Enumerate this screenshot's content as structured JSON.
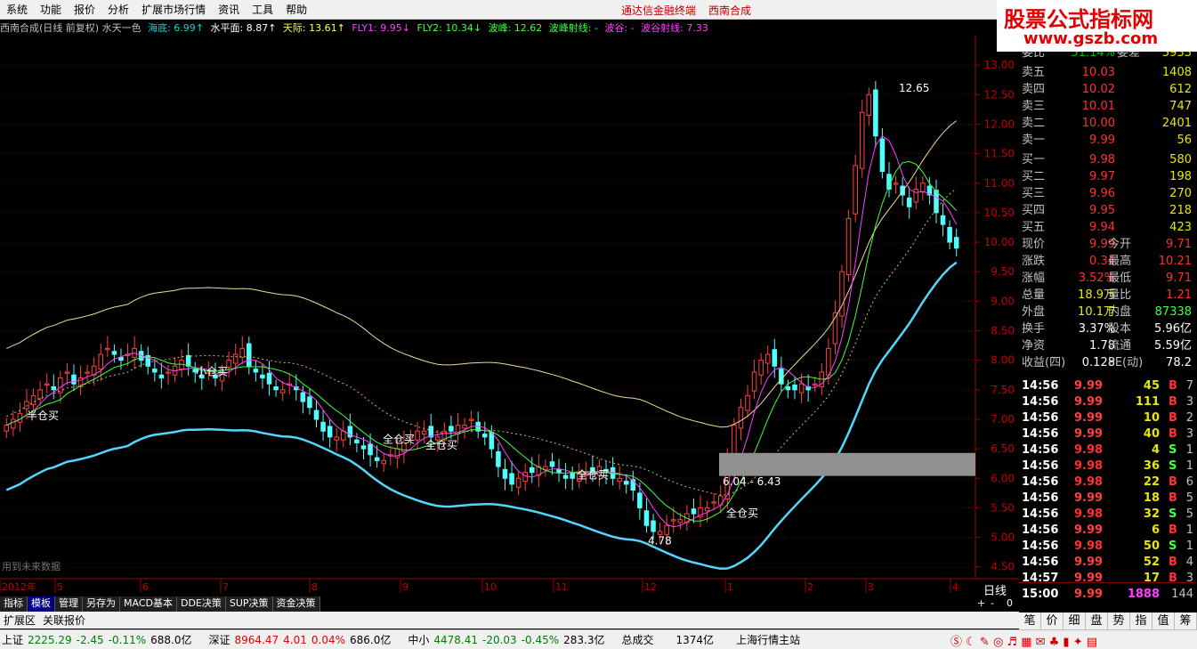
{
  "menu": [
    "系统",
    "功能",
    "报价",
    "分析",
    "扩展市场行情",
    "资讯",
    "工具",
    "帮助"
  ],
  "brand": "通达信金融终端",
  "brand_stock": "西南合成",
  "logo": {
    "l1": "股票公式指标网",
    "l2": "www.gszb.com"
  },
  "info": {
    "stock": "西南合成(日线 前复权) 水天一色",
    "haidi": "海底: 6.99↑",
    "shuiping": "水平面: 8.87↑",
    "tianji": "天际: 13.61↑",
    "fly1": "FLY1: 9.95↓",
    "fly2": "FLY2: 10.34↓",
    "bofeng": "波峰: 12.62",
    "bofeng_line": "波峰射线: -",
    "bogu": "波谷: -",
    "bogu_line": "波谷射线: 7.33"
  },
  "chart_data": {
    "type": "candlestick",
    "title": "西南合成(日线 前复权) 水天一色",
    "yticks": [
      "13.00",
      "12.50",
      "12.00",
      "11.50",
      "11.00",
      "10.50",
      "10.00",
      "9.50",
      "9.00",
      "8.50",
      "8.00",
      "7.50",
      "7.00",
      "6.50",
      "6.00",
      "5.50",
      "5.00",
      "4.50"
    ],
    "xticks": [
      "2012年",
      "5",
      "6",
      "7",
      "8",
      "9",
      "10",
      "11",
      "12",
      "1",
      "2",
      "3",
      "4"
    ],
    "ylim": [
      4.3,
      13.5
    ],
    "closes": [
      6.9,
      7.0,
      7.1,
      7.3,
      7.4,
      7.5,
      7.6,
      7.5,
      7.7,
      7.8,
      7.6,
      7.7,
      7.8,
      7.9,
      8.1,
      8.2,
      8.1,
      8.0,
      8.1,
      8.2,
      8.0,
      7.9,
      7.8,
      7.7,
      7.8,
      7.9,
      8.0,
      7.9,
      7.8,
      7.7,
      7.8,
      7.7,
      7.8,
      8.0,
      8.1,
      8.2,
      7.9,
      7.8,
      7.7,
      7.6,
      7.5,
      7.5,
      7.6,
      7.5,
      7.3,
      7.2,
      7.0,
      6.8,
      6.7,
      6.7,
      6.8,
      6.7,
      6.6,
      6.5,
      6.4,
      6.3,
      6.3,
      6.4,
      6.5,
      6.6,
      6.7,
      6.8,
      6.8,
      6.7,
      6.7,
      6.8,
      6.8,
      6.9,
      6.9,
      7.0,
      6.8,
      6.7,
      6.5,
      6.2,
      6.0,
      5.9,
      6.0,
      6.1,
      6.1,
      6.2,
      6.2,
      6.2,
      6.1,
      6.0,
      6.0,
      6.1,
      6.1,
      6.1,
      6.2,
      6.1,
      6.0,
      6.0,
      5.9,
      5.8,
      5.5,
      5.2,
      5.1,
      5.1,
      5.2,
      5.3,
      5.3,
      5.4,
      5.4,
      5.5,
      5.5,
      5.6,
      5.7,
      6.3,
      6.9,
      7.2,
      7.4,
      7.8,
      8.0,
      8.1,
      7.9,
      7.6,
      7.5,
      7.5,
      7.6,
      7.5,
      7.6,
      7.8,
      8.2,
      8.8,
      9.5,
      10.4,
      11.3,
      12.2,
      12.5,
      11.8,
      11.2,
      10.9,
      11.0,
      10.8,
      10.6,
      10.9,
      11.0,
      10.8,
      10.5,
      10.3,
      10.0,
      9.9
    ],
    "annotations": [
      "半仓买",
      "小仓买",
      "全仓买",
      "全仓买",
      "全仓买",
      "全仓买",
      "12.65",
      "6.04 - 6.43",
      "4.78"
    ],
    "note": "用到未来数据"
  },
  "panel": {
    "weibi_lab": "委比",
    "weibi": "51.14%",
    "weicha_lab": "委差",
    "weicha": "5933",
    "asks": [
      {
        "l": "卖五",
        "p": "10.03",
        "v": "1408"
      },
      {
        "l": "卖四",
        "p": "10.02",
        "v": "612"
      },
      {
        "l": "卖三",
        "p": "10.01",
        "v": "747"
      },
      {
        "l": "卖二",
        "p": "10.00",
        "v": "2401"
      },
      {
        "l": "卖一",
        "p": "9.99",
        "v": "56"
      }
    ],
    "bids": [
      {
        "l": "买一",
        "p": "9.98",
        "v": "580"
      },
      {
        "l": "买二",
        "p": "9.97",
        "v": "198"
      },
      {
        "l": "买三",
        "p": "9.96",
        "v": "270"
      },
      {
        "l": "买四",
        "p": "9.95",
        "v": "218"
      },
      {
        "l": "买五",
        "p": "9.94",
        "v": "423"
      }
    ],
    "stats": [
      {
        "a": "现价",
        "b": "9.99",
        "c": "今开",
        "d": "9.71"
      },
      {
        "a": "涨跌",
        "b": "0.34",
        "c": "最高",
        "d": "10.21"
      },
      {
        "a": "涨幅",
        "b": "3.52%",
        "c": "最低",
        "d": "9.71"
      },
      {
        "a": "总量",
        "b": "18.9万",
        "c": "量比",
        "d": "1.21"
      },
      {
        "a": "外盘",
        "b": "10.1万",
        "c": "内盘",
        "d": "87338"
      },
      {
        "a": "换手",
        "b": "3.37%",
        "c": "股本",
        "d": "5.96亿"
      },
      {
        "a": "净资",
        "b": "1.78",
        "c": "流通",
        "d": "5.59亿"
      },
      {
        "a": "收益(四)",
        "b": "0.128",
        "c": "PE(动)",
        "d": "78.2"
      }
    ],
    "ticks": [
      {
        "t": "14:56",
        "p": "9.99",
        "v": "45",
        "bs": "B",
        "n": "7"
      },
      {
        "t": "14:56",
        "p": "9.99",
        "v": "111",
        "bs": "B",
        "n": "3"
      },
      {
        "t": "14:56",
        "p": "9.99",
        "v": "10",
        "bs": "B",
        "n": "2"
      },
      {
        "t": "14:56",
        "p": "9.99",
        "v": "40",
        "bs": "B",
        "n": "3"
      },
      {
        "t": "14:56",
        "p": "9.98",
        "v": "4",
        "bs": "S",
        "n": "1"
      },
      {
        "t": "14:56",
        "p": "9.98",
        "v": "36",
        "bs": "S",
        "n": "1"
      },
      {
        "t": "14:56",
        "p": "9.98",
        "v": "22",
        "bs": "B",
        "n": "6"
      },
      {
        "t": "14:56",
        "p": "9.99",
        "v": "18",
        "bs": "B",
        "n": "5"
      },
      {
        "t": "14:56",
        "p": "9.98",
        "v": "32",
        "bs": "S",
        "n": "5"
      },
      {
        "t": "14:56",
        "p": "9.99",
        "v": "6",
        "bs": "B",
        "n": "1"
      },
      {
        "t": "14:56",
        "p": "9.98",
        "v": "50",
        "bs": "S",
        "n": "1"
      },
      {
        "t": "14:56",
        "p": "9.99",
        "v": "52",
        "bs": "B",
        "n": "4"
      },
      {
        "t": "14:57",
        "p": "9.99",
        "v": "17",
        "bs": "B",
        "n": "3"
      },
      {
        "t": "15:00",
        "p": "9.99",
        "v": "1888",
        "bs": "",
        "n": "144"
      }
    ],
    "period": "日线"
  },
  "tabs": [
    "指标",
    "模板",
    "管理",
    "另存为",
    "MACD基本",
    "DDE决策",
    "SUP决策",
    "资金决策"
  ],
  "ext": [
    "扩展区",
    "关联报价"
  ],
  "rtabs": [
    "笔",
    "价",
    "细",
    "盘",
    "势",
    "指",
    "值",
    "筹"
  ],
  "status": {
    "sh_lab": "上证",
    "sh": "2225.29",
    "sh_chg": "-2.45",
    "sh_pct": "-0.11%",
    "sh_amt": "688.0亿",
    "sz_lab": "深证",
    "sz": "8964.47",
    "sz_chg": "4.01",
    "sz_pct": "0.04%",
    "sz_amt": "686.0亿",
    "zx_lab": "中小",
    "zx": "4478.41",
    "zx_chg": "-20.03",
    "zx_pct": "-0.45%",
    "zx_amt": "283.3亿",
    "tot_lab": "总成交",
    "tot": "1374亿",
    "station": "上海行情主站"
  }
}
